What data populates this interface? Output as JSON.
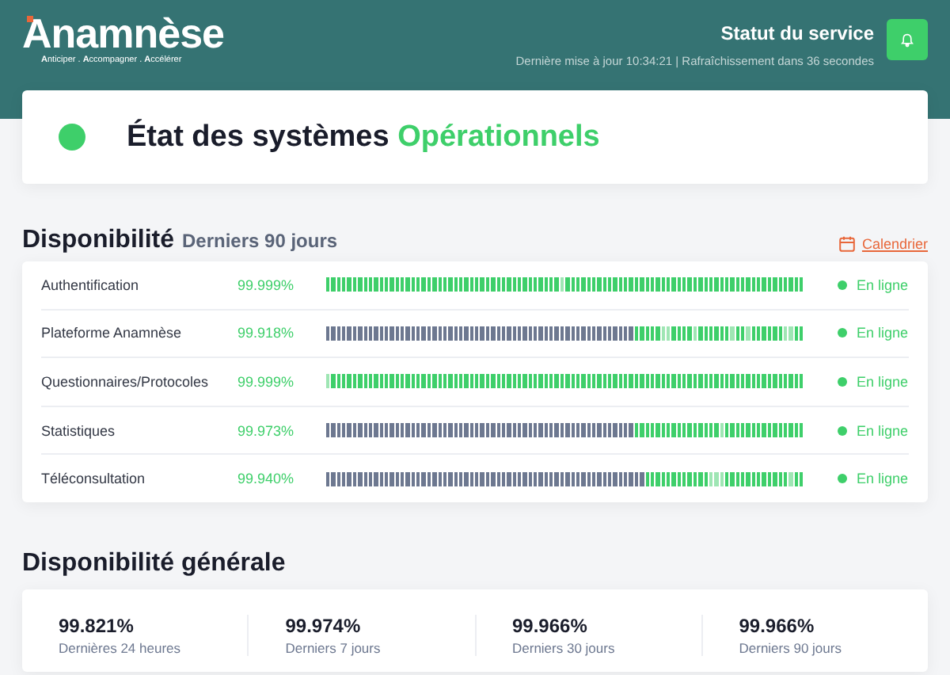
{
  "header": {
    "logo": "Anamnèse",
    "tagline": "**A**nticiper . **A**ccompagner . **A**ccélérer",
    "title": "Statut du service",
    "updated": "Dernière mise à jour 10:34:21 | Rafraîchissement dans 36 secondes"
  },
  "system_status": {
    "label": "État des systèmes",
    "value": "Opérationnels",
    "kind": "ok"
  },
  "availability": {
    "title": "Disponibilité",
    "subtitle": "Derniers 90 jours",
    "calendar_link": "Calendrier",
    "services": [
      {
        "name": "Authentification",
        "uptime": "99.999%",
        "status": "En ligne",
        "kind": "online",
        "history": [
          {
            "kind": "up"
          },
          {
            "kind": "up"
          },
          {
            "kind": "up"
          },
          {
            "kind": "up"
          },
          {
            "kind": "up"
          },
          {
            "kind": "up"
          },
          {
            "kind": "up"
          },
          {
            "kind": "up"
          },
          {
            "kind": "up"
          },
          {
            "kind": "up"
          },
          {
            "kind": "up"
          },
          {
            "kind": "up"
          },
          {
            "kind": "up"
          },
          {
            "kind": "up"
          },
          {
            "kind": "up"
          },
          {
            "kind": "up"
          },
          {
            "kind": "up"
          },
          {
            "kind": "up"
          },
          {
            "kind": "up"
          },
          {
            "kind": "up"
          },
          {
            "kind": "up"
          },
          {
            "kind": "up"
          },
          {
            "kind": "up"
          },
          {
            "kind": "up"
          },
          {
            "kind": "up"
          },
          {
            "kind": "up"
          },
          {
            "kind": "up"
          },
          {
            "kind": "up"
          },
          {
            "kind": "up"
          },
          {
            "kind": "up"
          },
          {
            "kind": "up"
          },
          {
            "kind": "up"
          },
          {
            "kind": "up"
          },
          {
            "kind": "up"
          },
          {
            "kind": "up"
          },
          {
            "kind": "up"
          },
          {
            "kind": "up"
          },
          {
            "kind": "up"
          },
          {
            "kind": "up"
          },
          {
            "kind": "up"
          },
          {
            "kind": "up"
          },
          {
            "kind": "up"
          },
          {
            "kind": "up"
          },
          {
            "kind": "up"
          },
          {
            "kind": "low"
          },
          {
            "kind": "up"
          },
          {
            "kind": "up"
          },
          {
            "kind": "up"
          },
          {
            "kind": "up"
          },
          {
            "kind": "up"
          },
          {
            "kind": "up"
          },
          {
            "kind": "up"
          },
          {
            "kind": "up"
          },
          {
            "kind": "up"
          },
          {
            "kind": "up"
          },
          {
            "kind": "up"
          },
          {
            "kind": "up"
          },
          {
            "kind": "up"
          },
          {
            "kind": "up"
          },
          {
            "kind": "up"
          },
          {
            "kind": "up"
          },
          {
            "kind": "up"
          },
          {
            "kind": "up"
          },
          {
            "kind": "up"
          },
          {
            "kind": "up"
          },
          {
            "kind": "up"
          },
          {
            "kind": "up"
          },
          {
            "kind": "up"
          },
          {
            "kind": "up"
          },
          {
            "kind": "up"
          },
          {
            "kind": "up"
          },
          {
            "kind": "up"
          },
          {
            "kind": "up"
          },
          {
            "kind": "up"
          },
          {
            "kind": "up"
          },
          {
            "kind": "up"
          },
          {
            "kind": "up"
          },
          {
            "kind": "up"
          },
          {
            "kind": "up"
          },
          {
            "kind": "up"
          },
          {
            "kind": "up"
          },
          {
            "kind": "up"
          },
          {
            "kind": "up"
          },
          {
            "kind": "up"
          },
          {
            "kind": "up"
          },
          {
            "kind": "up"
          },
          {
            "kind": "up"
          },
          {
            "kind": "up"
          },
          {
            "kind": "up"
          },
          {
            "kind": "up"
          }
        ]
      },
      {
        "name": "Plateforme Anamnèse",
        "uptime": "99.918%",
        "status": "En ligne",
        "kind": "online",
        "history": [
          {
            "kind": "none"
          },
          {
            "kind": "none"
          },
          {
            "kind": "none"
          },
          {
            "kind": "none"
          },
          {
            "kind": "none"
          },
          {
            "kind": "none"
          },
          {
            "kind": "none"
          },
          {
            "kind": "none"
          },
          {
            "kind": "none"
          },
          {
            "kind": "none"
          },
          {
            "kind": "none"
          },
          {
            "kind": "none"
          },
          {
            "kind": "none"
          },
          {
            "kind": "none"
          },
          {
            "kind": "none"
          },
          {
            "kind": "none"
          },
          {
            "kind": "none"
          },
          {
            "kind": "none"
          },
          {
            "kind": "none"
          },
          {
            "kind": "none"
          },
          {
            "kind": "none"
          },
          {
            "kind": "none"
          },
          {
            "kind": "none"
          },
          {
            "kind": "none"
          },
          {
            "kind": "none"
          },
          {
            "kind": "none"
          },
          {
            "kind": "none"
          },
          {
            "kind": "none"
          },
          {
            "kind": "none"
          },
          {
            "kind": "none"
          },
          {
            "kind": "none"
          },
          {
            "kind": "none"
          },
          {
            "kind": "none"
          },
          {
            "kind": "none"
          },
          {
            "kind": "none"
          },
          {
            "kind": "none"
          },
          {
            "kind": "none"
          },
          {
            "kind": "none"
          },
          {
            "kind": "none"
          },
          {
            "kind": "none"
          },
          {
            "kind": "none"
          },
          {
            "kind": "none"
          },
          {
            "kind": "none"
          },
          {
            "kind": "none"
          },
          {
            "kind": "none"
          },
          {
            "kind": "none"
          },
          {
            "kind": "none"
          },
          {
            "kind": "none"
          },
          {
            "kind": "none"
          },
          {
            "kind": "none"
          },
          {
            "kind": "none"
          },
          {
            "kind": "none"
          },
          {
            "kind": "none"
          },
          {
            "kind": "none"
          },
          {
            "kind": "none"
          },
          {
            "kind": "none"
          },
          {
            "kind": "none"
          },
          {
            "kind": "none"
          },
          {
            "kind": "up"
          },
          {
            "kind": "up"
          },
          {
            "kind": "up"
          },
          {
            "kind": "up"
          },
          {
            "kind": "up"
          },
          {
            "kind": "low"
          },
          {
            "kind": "low"
          },
          {
            "kind": "up"
          },
          {
            "kind": "up"
          },
          {
            "kind": "up"
          },
          {
            "kind": "up"
          },
          {
            "kind": "low"
          },
          {
            "kind": "up"
          },
          {
            "kind": "up"
          },
          {
            "kind": "up"
          },
          {
            "kind": "up"
          },
          {
            "kind": "up"
          },
          {
            "kind": "up"
          },
          {
            "kind": "low"
          },
          {
            "kind": "up"
          },
          {
            "kind": "up"
          },
          {
            "kind": "low"
          },
          {
            "kind": "up"
          },
          {
            "kind": "up"
          },
          {
            "kind": "up"
          },
          {
            "kind": "up"
          },
          {
            "kind": "up"
          },
          {
            "kind": "up"
          },
          {
            "kind": "low"
          },
          {
            "kind": "low"
          },
          {
            "kind": "up"
          },
          {
            "kind": "up"
          }
        ]
      },
      {
        "name": "Questionnaires/Protocoles",
        "uptime": "99.999%",
        "status": "En ligne",
        "kind": "online",
        "history": [
          {
            "kind": "low"
          },
          {
            "kind": "up"
          },
          {
            "kind": "up"
          },
          {
            "kind": "up"
          },
          {
            "kind": "up"
          },
          {
            "kind": "up"
          },
          {
            "kind": "up"
          },
          {
            "kind": "up"
          },
          {
            "kind": "up"
          },
          {
            "kind": "up"
          },
          {
            "kind": "up"
          },
          {
            "kind": "up"
          },
          {
            "kind": "up"
          },
          {
            "kind": "up"
          },
          {
            "kind": "up"
          },
          {
            "kind": "up"
          },
          {
            "kind": "up"
          },
          {
            "kind": "up"
          },
          {
            "kind": "up"
          },
          {
            "kind": "up"
          },
          {
            "kind": "up"
          },
          {
            "kind": "up"
          },
          {
            "kind": "up"
          },
          {
            "kind": "up"
          },
          {
            "kind": "up"
          },
          {
            "kind": "up"
          },
          {
            "kind": "up"
          },
          {
            "kind": "up"
          },
          {
            "kind": "up"
          },
          {
            "kind": "up"
          },
          {
            "kind": "up"
          },
          {
            "kind": "up"
          },
          {
            "kind": "up"
          },
          {
            "kind": "up"
          },
          {
            "kind": "up"
          },
          {
            "kind": "up"
          },
          {
            "kind": "up"
          },
          {
            "kind": "up"
          },
          {
            "kind": "up"
          },
          {
            "kind": "up"
          },
          {
            "kind": "up"
          },
          {
            "kind": "up"
          },
          {
            "kind": "up"
          },
          {
            "kind": "up"
          },
          {
            "kind": "up"
          },
          {
            "kind": "up"
          },
          {
            "kind": "up"
          },
          {
            "kind": "up"
          },
          {
            "kind": "up"
          },
          {
            "kind": "up"
          },
          {
            "kind": "up"
          },
          {
            "kind": "up"
          },
          {
            "kind": "up"
          },
          {
            "kind": "up"
          },
          {
            "kind": "up"
          },
          {
            "kind": "up"
          },
          {
            "kind": "up"
          },
          {
            "kind": "up"
          },
          {
            "kind": "up"
          },
          {
            "kind": "up"
          },
          {
            "kind": "up"
          },
          {
            "kind": "up"
          },
          {
            "kind": "up"
          },
          {
            "kind": "up"
          },
          {
            "kind": "up"
          },
          {
            "kind": "up"
          },
          {
            "kind": "up"
          },
          {
            "kind": "up"
          },
          {
            "kind": "up"
          },
          {
            "kind": "up"
          },
          {
            "kind": "up"
          },
          {
            "kind": "up"
          },
          {
            "kind": "up"
          },
          {
            "kind": "up"
          },
          {
            "kind": "up"
          },
          {
            "kind": "up"
          },
          {
            "kind": "up"
          },
          {
            "kind": "up"
          },
          {
            "kind": "up"
          },
          {
            "kind": "up"
          },
          {
            "kind": "up"
          },
          {
            "kind": "up"
          },
          {
            "kind": "up"
          },
          {
            "kind": "up"
          },
          {
            "kind": "up"
          },
          {
            "kind": "up"
          },
          {
            "kind": "up"
          },
          {
            "kind": "up"
          },
          {
            "kind": "up"
          },
          {
            "kind": "up"
          }
        ]
      },
      {
        "name": "Statistiques",
        "uptime": "99.973%",
        "status": "En ligne",
        "kind": "online",
        "history": [
          {
            "kind": "none"
          },
          {
            "kind": "none"
          },
          {
            "kind": "none"
          },
          {
            "kind": "none"
          },
          {
            "kind": "none"
          },
          {
            "kind": "none"
          },
          {
            "kind": "none"
          },
          {
            "kind": "none"
          },
          {
            "kind": "none"
          },
          {
            "kind": "none"
          },
          {
            "kind": "none"
          },
          {
            "kind": "none"
          },
          {
            "kind": "none"
          },
          {
            "kind": "none"
          },
          {
            "kind": "none"
          },
          {
            "kind": "none"
          },
          {
            "kind": "none"
          },
          {
            "kind": "none"
          },
          {
            "kind": "none"
          },
          {
            "kind": "none"
          },
          {
            "kind": "none"
          },
          {
            "kind": "none"
          },
          {
            "kind": "none"
          },
          {
            "kind": "none"
          },
          {
            "kind": "none"
          },
          {
            "kind": "none"
          },
          {
            "kind": "none"
          },
          {
            "kind": "none"
          },
          {
            "kind": "none"
          },
          {
            "kind": "none"
          },
          {
            "kind": "none"
          },
          {
            "kind": "none"
          },
          {
            "kind": "none"
          },
          {
            "kind": "none"
          },
          {
            "kind": "none"
          },
          {
            "kind": "none"
          },
          {
            "kind": "none"
          },
          {
            "kind": "none"
          },
          {
            "kind": "none"
          },
          {
            "kind": "none"
          },
          {
            "kind": "none"
          },
          {
            "kind": "none"
          },
          {
            "kind": "none"
          },
          {
            "kind": "none"
          },
          {
            "kind": "none"
          },
          {
            "kind": "none"
          },
          {
            "kind": "none"
          },
          {
            "kind": "none"
          },
          {
            "kind": "none"
          },
          {
            "kind": "none"
          },
          {
            "kind": "none"
          },
          {
            "kind": "none"
          },
          {
            "kind": "none"
          },
          {
            "kind": "none"
          },
          {
            "kind": "none"
          },
          {
            "kind": "none"
          },
          {
            "kind": "none"
          },
          {
            "kind": "none"
          },
          {
            "kind": "up"
          },
          {
            "kind": "up"
          },
          {
            "kind": "up"
          },
          {
            "kind": "up"
          },
          {
            "kind": "up"
          },
          {
            "kind": "up"
          },
          {
            "kind": "up"
          },
          {
            "kind": "up"
          },
          {
            "kind": "up"
          },
          {
            "kind": "up"
          },
          {
            "kind": "up"
          },
          {
            "kind": "up"
          },
          {
            "kind": "up"
          },
          {
            "kind": "up"
          },
          {
            "kind": "up"
          },
          {
            "kind": "up"
          },
          {
            "kind": "low"
          },
          {
            "kind": "up"
          },
          {
            "kind": "up"
          },
          {
            "kind": "up"
          },
          {
            "kind": "up"
          },
          {
            "kind": "up"
          },
          {
            "kind": "up"
          },
          {
            "kind": "up"
          },
          {
            "kind": "up"
          },
          {
            "kind": "up"
          },
          {
            "kind": "up"
          },
          {
            "kind": "up"
          },
          {
            "kind": "up"
          },
          {
            "kind": "up"
          },
          {
            "kind": "up"
          },
          {
            "kind": "up"
          }
        ]
      },
      {
        "name": "Téléconsultation",
        "uptime": "99.940%",
        "status": "En ligne",
        "kind": "online",
        "history": [
          {
            "kind": "none"
          },
          {
            "kind": "none"
          },
          {
            "kind": "none"
          },
          {
            "kind": "none"
          },
          {
            "kind": "none"
          },
          {
            "kind": "none"
          },
          {
            "kind": "none"
          },
          {
            "kind": "none"
          },
          {
            "kind": "none"
          },
          {
            "kind": "none"
          },
          {
            "kind": "none"
          },
          {
            "kind": "none"
          },
          {
            "kind": "none"
          },
          {
            "kind": "none"
          },
          {
            "kind": "none"
          },
          {
            "kind": "none"
          },
          {
            "kind": "none"
          },
          {
            "kind": "none"
          },
          {
            "kind": "none"
          },
          {
            "kind": "none"
          },
          {
            "kind": "none"
          },
          {
            "kind": "none"
          },
          {
            "kind": "none"
          },
          {
            "kind": "none"
          },
          {
            "kind": "none"
          },
          {
            "kind": "none"
          },
          {
            "kind": "none"
          },
          {
            "kind": "none"
          },
          {
            "kind": "none"
          },
          {
            "kind": "none"
          },
          {
            "kind": "none"
          },
          {
            "kind": "none"
          },
          {
            "kind": "none"
          },
          {
            "kind": "none"
          },
          {
            "kind": "none"
          },
          {
            "kind": "none"
          },
          {
            "kind": "none"
          },
          {
            "kind": "none"
          },
          {
            "kind": "none"
          },
          {
            "kind": "none"
          },
          {
            "kind": "none"
          },
          {
            "kind": "none"
          },
          {
            "kind": "none"
          },
          {
            "kind": "none"
          },
          {
            "kind": "none"
          },
          {
            "kind": "none"
          },
          {
            "kind": "none"
          },
          {
            "kind": "none"
          },
          {
            "kind": "none"
          },
          {
            "kind": "none"
          },
          {
            "kind": "none"
          },
          {
            "kind": "none"
          },
          {
            "kind": "none"
          },
          {
            "kind": "none"
          },
          {
            "kind": "none"
          },
          {
            "kind": "none"
          },
          {
            "kind": "none"
          },
          {
            "kind": "none"
          },
          {
            "kind": "none"
          },
          {
            "kind": "none"
          },
          {
            "kind": "up"
          },
          {
            "kind": "up"
          },
          {
            "kind": "up"
          },
          {
            "kind": "up"
          },
          {
            "kind": "up"
          },
          {
            "kind": "up"
          },
          {
            "kind": "up"
          },
          {
            "kind": "up"
          },
          {
            "kind": "up"
          },
          {
            "kind": "up"
          },
          {
            "kind": "up"
          },
          {
            "kind": "up"
          },
          {
            "kind": "low"
          },
          {
            "kind": "low"
          },
          {
            "kind": "low"
          },
          {
            "kind": "up"
          },
          {
            "kind": "up"
          },
          {
            "kind": "up"
          },
          {
            "kind": "up"
          },
          {
            "kind": "up"
          },
          {
            "kind": "up"
          },
          {
            "kind": "up"
          },
          {
            "kind": "up"
          },
          {
            "kind": "up"
          },
          {
            "kind": "up"
          },
          {
            "kind": "up"
          },
          {
            "kind": "up"
          },
          {
            "kind": "low"
          },
          {
            "kind": "up"
          },
          {
            "kind": "up"
          }
        ]
      }
    ]
  },
  "overall": {
    "title": "Disponibilité générale",
    "stats": [
      {
        "value": "99.821%",
        "label": "Dernières 24 heures"
      },
      {
        "value": "99.974%",
        "label": "Derniers 7 jours"
      },
      {
        "value": "99.966%",
        "label": "Derniers 30 jours"
      },
      {
        "value": "99.966%",
        "label": "Derniers 90 jours"
      }
    ]
  }
}
